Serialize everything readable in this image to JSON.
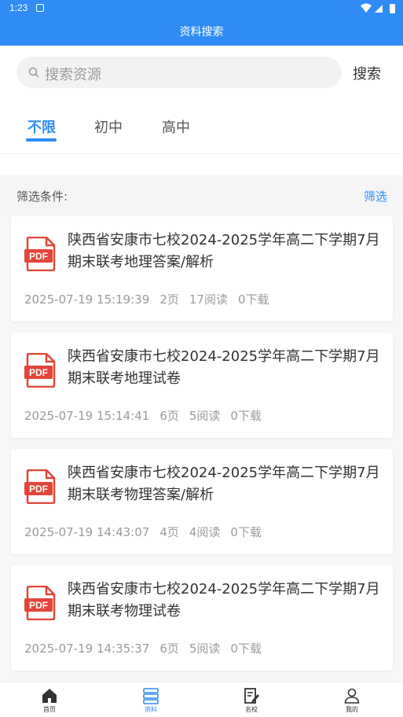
{
  "status_bar": {
    "time": "1:23"
  },
  "app_bar": {
    "title": "资料搜索"
  },
  "search": {
    "placeholder": "搜索资源",
    "button_label": "搜索"
  },
  "tabs": [
    {
      "label": "不限",
      "active": true
    },
    {
      "label": "初中",
      "active": false
    },
    {
      "label": "高中",
      "active": false
    }
  ],
  "filter": {
    "label": "筛选条件:",
    "button_label": "筛选"
  },
  "items": [
    {
      "icon": "pdf-icon",
      "title": "陕西省安康市七校2024-2025学年高二下学期7月期末联考地理答案/解析",
      "date": "2025-07-19 15:19:39",
      "pages": "2页",
      "reads": "17阅读",
      "downloads": "0下载"
    },
    {
      "icon": "pdf-icon",
      "title": "陕西省安康市七校2024-2025学年高二下学期7月期末联考地理试卷",
      "date": "2025-07-19 15:14:41",
      "pages": "6页",
      "reads": "5阅读",
      "downloads": "0下载"
    },
    {
      "icon": "pdf-icon",
      "title": "陕西省安康市七校2024-2025学年高二下学期7月期末联考物理答案/解析",
      "date": "2025-07-19 14:43:07",
      "pages": "4页",
      "reads": "4阅读",
      "downloads": "0下载"
    },
    {
      "icon": "pdf-icon",
      "title": "陕西省安康市七校2024-2025学年高二下学期7月期末联考物理试卷",
      "date": "2025-07-19 14:35:37",
      "pages": "6页",
      "reads": "5阅读",
      "downloads": "0下载"
    }
  ],
  "bottom_nav": [
    {
      "label": "首页",
      "icon": "home-icon",
      "active": false
    },
    {
      "label": "资料",
      "icon": "materials-icon",
      "active": true
    },
    {
      "label": "名校",
      "icon": "school-icon",
      "active": false
    },
    {
      "label": "我的",
      "icon": "profile-icon",
      "active": false
    }
  ],
  "colors": {
    "accent": "#2f8cf5",
    "pdf_red": "#e2463a"
  }
}
